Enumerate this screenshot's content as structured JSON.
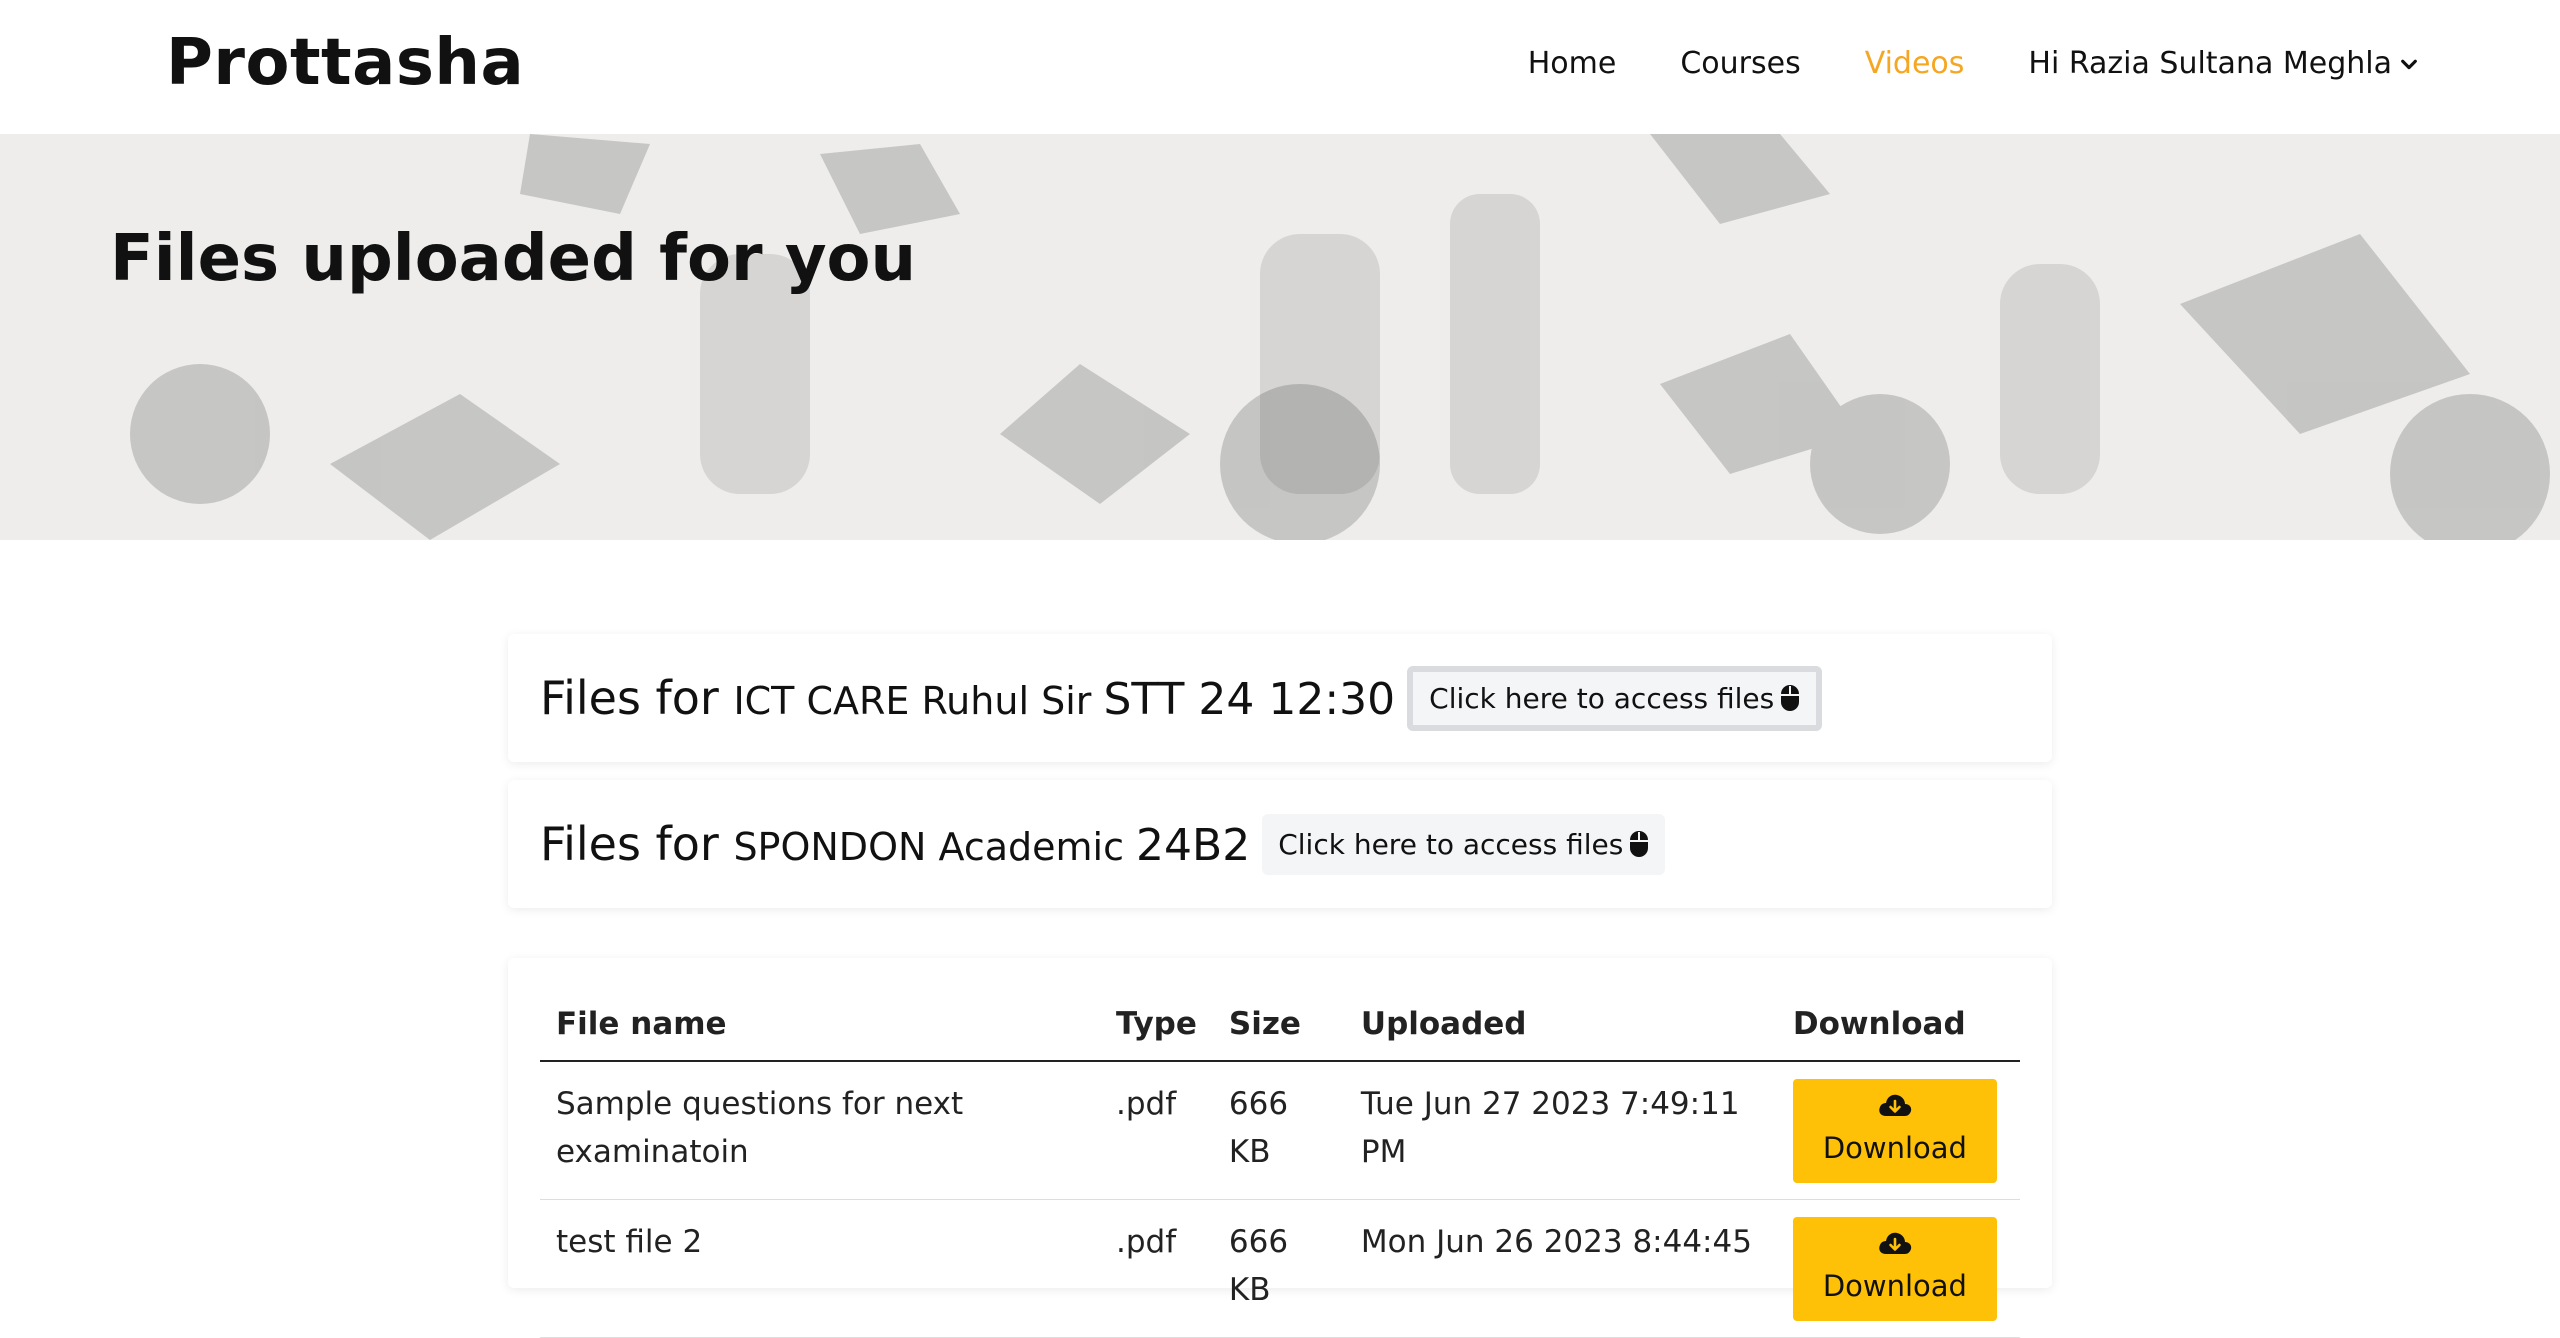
{
  "brand": "Prottasha",
  "nav": {
    "home": "Home",
    "courses": "Courses",
    "videos": "Videos",
    "user": "Hi Razia Sultana Meghla"
  },
  "hero": {
    "title": "Files uploaded for you"
  },
  "groups": [
    {
      "prefix": "Files for ",
      "name": "ICT CARE Ruhul Sir ",
      "tail": "STT 24 12:30",
      "button": "Click here to access files"
    },
    {
      "prefix": "Files for ",
      "name": "SPONDON Academic ",
      "tail": "24B2",
      "button": "Click here to access files"
    }
  ],
  "table": {
    "headers": [
      "File name",
      "Type",
      "Size",
      "Uploaded",
      "Download"
    ],
    "rows": [
      {
        "name": "Sample questions for next examinatoin",
        "type": ".pdf",
        "size": "666 KB",
        "uploaded": "Tue Jun 27 2023 7:49:11 PM",
        "download": "Download"
      },
      {
        "name": "test file 2",
        "type": ".pdf",
        "size": "666 KB",
        "uploaded": "Mon Jun 26 2023 8:44:45",
        "download": "Download"
      }
    ]
  },
  "colors": {
    "accent": "#f5a623",
    "button": "#ffc107"
  },
  "icons": {
    "user_menu": "chevron-down-icon",
    "access": "mouse-icon",
    "download": "cloud-download-icon"
  }
}
